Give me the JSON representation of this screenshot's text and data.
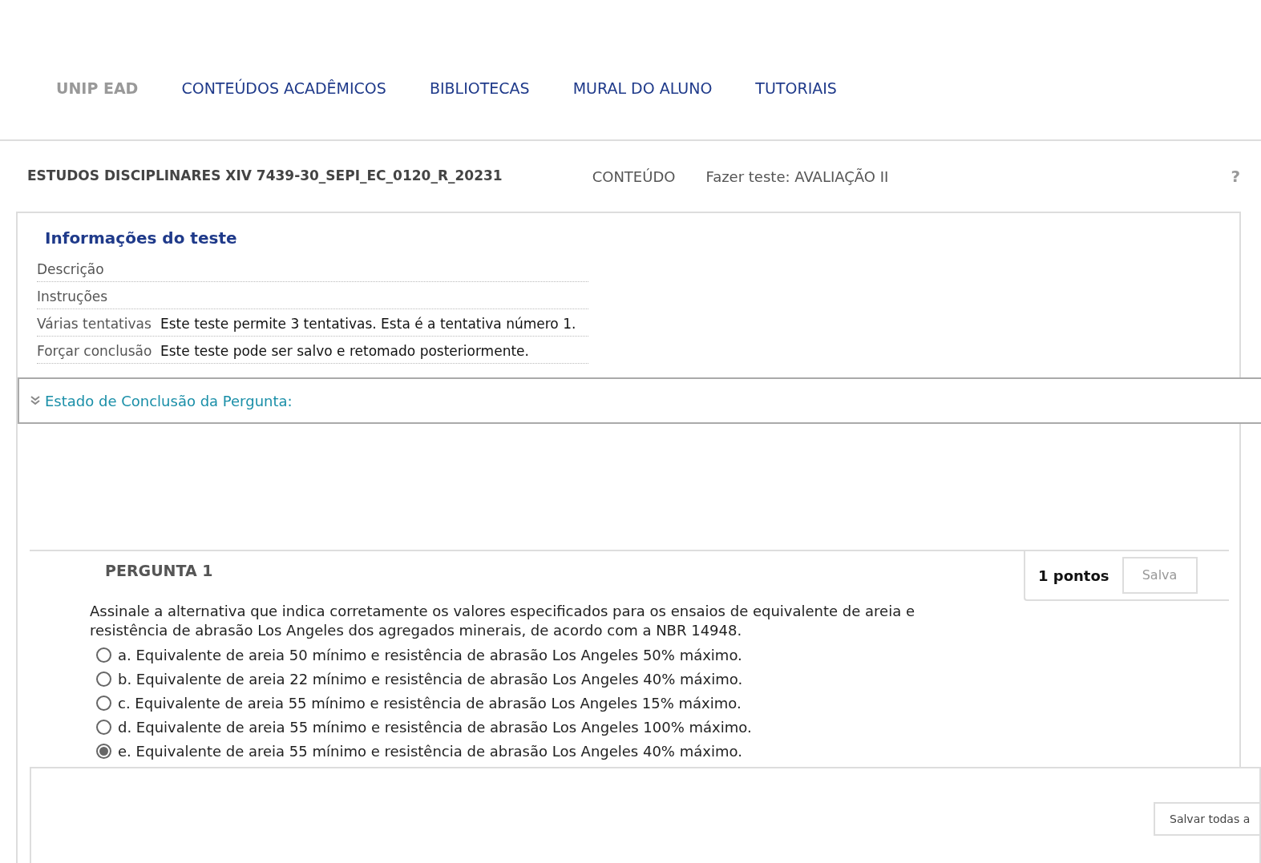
{
  "nav": [
    {
      "label": "UNIP EAD",
      "kind": "brand"
    },
    {
      "label": "CONTEÚDOS ACADÊMICOS",
      "kind": "link"
    },
    {
      "label": "BIBLIOTECAS",
      "kind": "link"
    },
    {
      "label": "MURAL DO ALUNO",
      "kind": "link"
    },
    {
      "label": "TUTORIAIS",
      "kind": "link"
    }
  ],
  "breadcrumb": {
    "course": "ESTUDOS DISCIPLINARES XIV 7439-30_SEPI_EC_0120_R_20231",
    "items": [
      "CONTEÚDO",
      "Fazer teste: AVALIAÇÃO II"
    ],
    "help": "?"
  },
  "info": {
    "title": "Informações do teste",
    "rows": [
      {
        "label": "Descrição",
        "value": ""
      },
      {
        "label": "Instruções",
        "value": ""
      },
      {
        "label": "Várias tentativas",
        "value": "Este teste permite 3 tentativas. Esta é a tentativa número 1."
      },
      {
        "label": "Forçar conclusão",
        "value": "Este teste pode ser salvo e retomado posteriormente."
      }
    ]
  },
  "status_bar": {
    "label": "Estado de Conclusão da Pergunta:",
    "expanded": false
  },
  "question": {
    "title": "PERGUNTA 1",
    "points": "1 pontos",
    "save": "Salva",
    "text": "Assinale a alternativa que indica corretamente os valores especificados para os ensaios de equivalente de areia e resistência de abrasão Los Angeles dos agregados minerais, de acordo com a NBR 14948.",
    "options": [
      {
        "letter": "a.",
        "text": "Equivalente de areia 50 mínimo e resistência de abrasão Los Angeles 50% máximo.",
        "selected": false
      },
      {
        "letter": "b.",
        "text": "Equivalente de areia 22 mínimo e resistência de abrasão Los Angeles 40% máximo.",
        "selected": false
      },
      {
        "letter": "c.",
        "text": "Equivalente de areia 55 mínimo e resistência de abrasão Los Angeles 15% máximo.",
        "selected": false
      },
      {
        "letter": "d.",
        "text": "Equivalente de areia 55 mínimo e resistência de abrasão Los Angeles 100% máximo.",
        "selected": false
      },
      {
        "letter": "e.",
        "text": "Equivalente de areia 55 mínimo e resistência de abrasão Los Angeles 40% máximo.",
        "selected": true
      }
    ]
  },
  "footer": {
    "button": "Salvar todas a"
  }
}
